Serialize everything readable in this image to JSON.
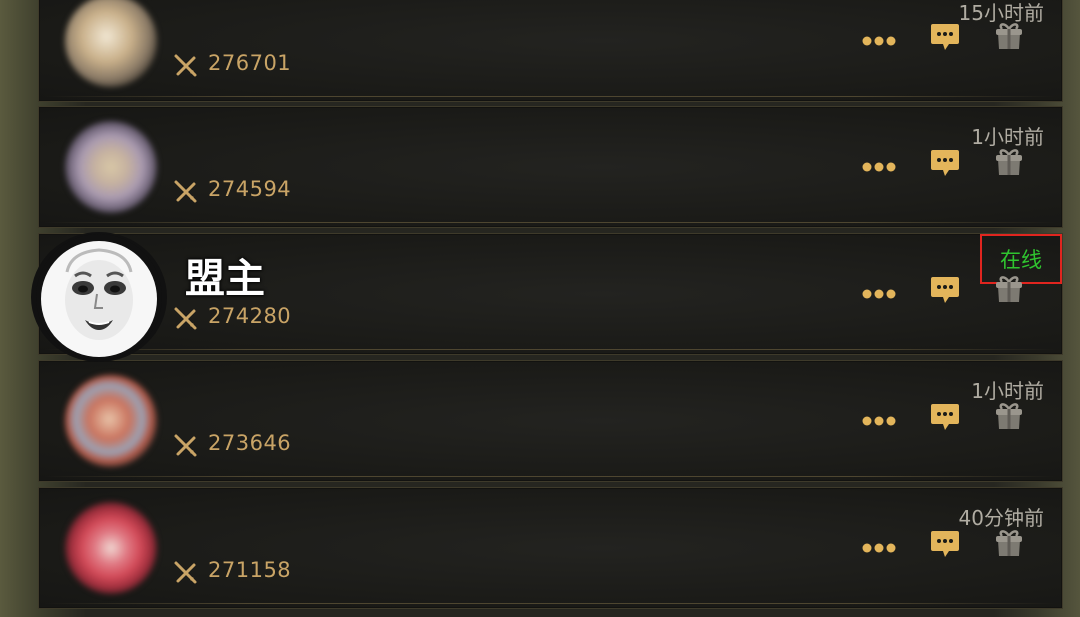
{
  "members": [
    {
      "power": "276701",
      "last_seen": "15小时前",
      "avatar_color": "#c9b08a",
      "avatar_accent": "#8a7a66"
    },
    {
      "power": "274594",
      "last_seen": "1小时前",
      "avatar_color": "#a99ab0",
      "avatar_accent": "#d8c7a6"
    },
    {
      "name": "盟主",
      "power": "274280",
      "status": "在线",
      "is_leader": true
    },
    {
      "power": "273646",
      "last_seen": "1小时前",
      "avatar_color": "#c9735e",
      "avatar_accent": "#9aa3b6"
    },
    {
      "power": "271158",
      "last_seen": "40分钟前",
      "avatar_color": "#d24a58",
      "avatar_accent": "#f0d7d2"
    }
  ],
  "colors": {
    "power_text": "#c9a466",
    "online_text": "#2fc42f",
    "highlight_border": "#e0251f",
    "button_gold": "#e3b55b"
  },
  "icons": {
    "power": "crossed-swords-icon",
    "more": "more-dots-icon",
    "chat": "chat-bubble-icon",
    "gift": "gift-icon"
  }
}
